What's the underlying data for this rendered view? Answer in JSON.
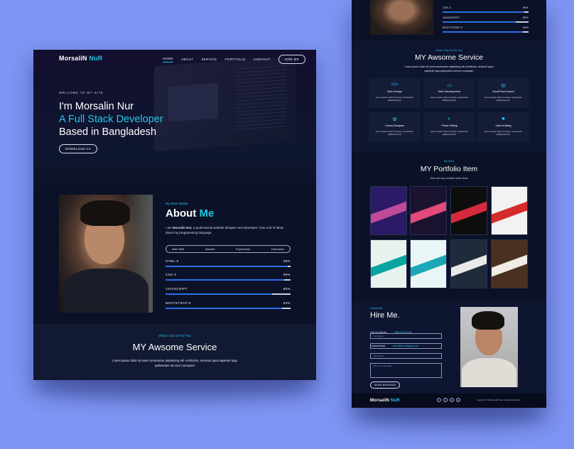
{
  "colors": {
    "background": "#7f95f3",
    "page": "#0b1126",
    "accent": "#23c6e8",
    "bar": "#2d6ee6"
  },
  "brand": {
    "name": "MorsaliN",
    "highlight": "NuR"
  },
  "nav": {
    "items": [
      "HOME",
      "ABOUT",
      "SERVICE",
      "PORTFOLIO",
      "CONTACT"
    ],
    "cta": "HIRE ME"
  },
  "hero": {
    "welcome": "WELCOME TO MY SITE",
    "line1": "I'm Morsalin Nur",
    "line2": "A Full Stack Developer",
    "line3": "Based in Bangladesh",
    "button": "DOWNLOAD CV"
  },
  "about": {
    "sub": "My About Details",
    "title": "About",
    "title_hl": "Me",
    "text_prefix": "I am",
    "text_name": "Morsalin Nur,",
    "text_rest": "a professional website designer and developer I has a lot of ideas about my programming language.",
    "tabs": [
      "Main Skill",
      "Awards",
      "Experience",
      "Education"
    ],
    "skills": [
      {
        "name": "HTML-5",
        "percent_label": "98%",
        "value": 98
      },
      {
        "name": "CSS-3",
        "percent_label": "95%",
        "value": 95
      },
      {
        "name": "JAVASCRIPT",
        "percent_label": "85%",
        "value": 85
      },
      {
        "name": "BOOTSTRAP-5",
        "percent_label": "93%",
        "value": 93
      }
    ]
  },
  "service": {
    "sub": "What I Can Do For You",
    "title": "MY Awsome Service",
    "text": "Lorem ipsum dolor sit amet consectetur adipisicing elit. Architecto, nesciunt quos sapiente fuga quibusdam ad error numquam",
    "cards": [
      {
        "icon": "code-icon",
        "glyph": "</>",
        "name": "Web Design"
      },
      {
        "icon": "monitor-icon",
        "glyph": "▭",
        "name": "Web Development"
      },
      {
        "icon": "wordpress-icon",
        "glyph": "Ⓦ",
        "name": "WordPress Expert"
      },
      {
        "icon": "canva-icon",
        "glyph": "✿",
        "name": "Canva Designer"
      },
      {
        "icon": "contrast-icon",
        "glyph": "◐",
        "name": "Photo Editing"
      },
      {
        "icon": "video-icon",
        "glyph": "■",
        "name": "Video Editing"
      }
    ],
    "card_text": "Lorem ipsum dolor sit amet, consectetur adipisicing elit."
  },
  "portfolio": {
    "sub": "My Work",
    "title": "MY Portfolio Item",
    "text": "Here are my excellent work show",
    "tiles": [
      {
        "name": "tile-1",
        "c1": "#2b1b66",
        "c2": "#c04a9a"
      },
      {
        "name": "tile-2",
        "c1": "#1b1230",
        "c2": "#e34a7a"
      },
      {
        "name": "tile-3",
        "c1": "#0d0d0d",
        "c2": "#d62a3c"
      },
      {
        "name": "tile-4",
        "c1": "#f2f2f2",
        "c2": "#d52b2b"
      },
      {
        "name": "tile-5",
        "c1": "#e8f3ef",
        "c2": "#0aa4a0"
      },
      {
        "name": "tile-6",
        "c1": "#e9f6f5",
        "c2": "#1aa7b6"
      },
      {
        "name": "tile-7",
        "c1": "#1f2a3a",
        "c2": "#e9e9e9"
      },
      {
        "name": "tile-8",
        "c1": "#4a3020",
        "c2": "#f1ede6"
      }
    ]
  },
  "hire": {
    "sub": "Contact Me",
    "title": "Hire Me.",
    "call_label": "Call Us Directly",
    "call_value": "+8801XXXXXXX",
    "email_label": "Contact Email",
    "email_value": "morsalinnur@gmail.com",
    "fields": [
      "Your Name",
      "Your Email",
      "Your Phone",
      "Write Your Message"
    ],
    "button": "SEND MESSAGE"
  },
  "footer": {
    "copyright": "Copyright © 2023 MorsaliN NuR. All Rights Reserved.",
    "social": [
      "f",
      "t",
      "in",
      "ig"
    ]
  }
}
